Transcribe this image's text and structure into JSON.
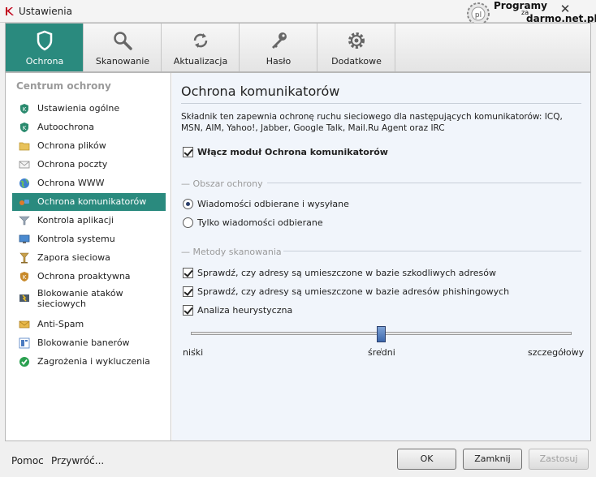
{
  "window": {
    "title": "Ustawienia",
    "watermark_line1": "Programy",
    "watermark_line2": "za",
    "watermark_line3": "darmo.net.pl"
  },
  "toolbar": {
    "tabs": [
      {
        "label": "Ochrona",
        "icon": "shield-icon",
        "active": true
      },
      {
        "label": "Skanowanie",
        "icon": "magnifier-icon",
        "active": false
      },
      {
        "label": "Aktualizacja",
        "icon": "refresh-icon",
        "active": false
      },
      {
        "label": "Hasło",
        "icon": "key-icon",
        "active": false
      },
      {
        "label": "Dodatkowe",
        "icon": "gear-icon",
        "active": false
      }
    ]
  },
  "sidebar": {
    "heading": "Centrum ochrony",
    "items": [
      {
        "label": "Ustawienia ogólne",
        "icon": "shield-k-icon"
      },
      {
        "label": "Autoochrona",
        "icon": "shield-k-icon"
      },
      {
        "label": "Ochrona plików",
        "icon": "folder-icon"
      },
      {
        "label": "Ochrona poczty",
        "icon": "envelope-icon"
      },
      {
        "label": "Ochrona WWW",
        "icon": "globe-icon"
      },
      {
        "label": "Ochrona komunikatorów",
        "icon": "messenger-icon",
        "active": true
      },
      {
        "label": "Kontrola aplikacji",
        "icon": "funnel-icon"
      },
      {
        "label": "Kontrola systemu",
        "icon": "monitor-icon"
      },
      {
        "label": "Zapora sieciowa",
        "icon": "firewall-icon"
      },
      {
        "label": "Ochrona proaktywna",
        "icon": "shield-k-icon"
      },
      {
        "label": "Blokowanie ataków sieciowych",
        "icon": "network-attack-icon"
      },
      {
        "label": "Anti-Spam",
        "icon": "spam-icon"
      },
      {
        "label": "Blokowanie banerów",
        "icon": "banner-icon"
      },
      {
        "label": "Zagrożenia i wykluczenia",
        "icon": "check-circle-icon"
      }
    ]
  },
  "content": {
    "title": "Ochrona komunikatorów",
    "description": "Składnik ten zapewnia ochronę ruchu sieciowego dla następujących komunikatorów: ICQ, MSN, AIM, Yahoo!, Jabber, Google Talk, Mail.Ru Agent oraz IRC",
    "enable_label": "Włącz moduł Ochrona komunikatorów",
    "enable_checked": true,
    "scope_section": "Obszar ochrony",
    "scope_options": [
      {
        "label": "Wiadomości odbierane i wysyłane",
        "selected": true
      },
      {
        "label": "Tylko wiadomości odbierane",
        "selected": false
      }
    ],
    "methods_section": "Metody skanowania",
    "methods": [
      {
        "label": "Sprawdź, czy adresy są umieszczone w bazie szkodliwych adresów",
        "checked": true
      },
      {
        "label": "Sprawdź, czy adresy są umieszczone w bazie adresów phishingowych",
        "checked": true
      },
      {
        "label": "Analiza heurystyczna",
        "checked": true
      }
    ],
    "slider": {
      "labels": [
        "niski",
        "średni",
        "szczegółowy"
      ],
      "value": "średni"
    }
  },
  "footer": {
    "help": "Pomoc",
    "restore": "Przywróć...",
    "ok": "OK",
    "close": "Zamknij",
    "apply": "Zastosuj"
  },
  "colors": {
    "accent": "#2a8a7e",
    "content_bg": "#f1f5fb"
  }
}
